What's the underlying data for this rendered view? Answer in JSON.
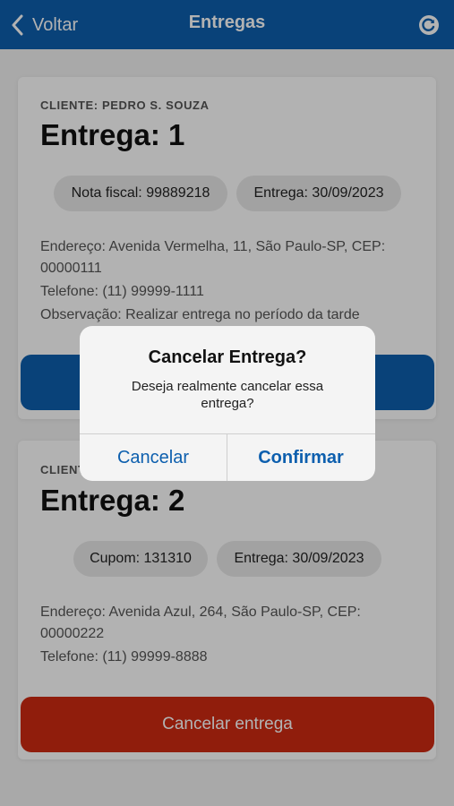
{
  "header": {
    "back_label": "Voltar",
    "title": "Entregas"
  },
  "deliveries": [
    {
      "client": "CLIENTE: PEDRO S. SOUZA",
      "title": "Entrega: 1",
      "chip1": "Nota fiscal: 99889218",
      "chip2": "Entrega: 30/09/2023",
      "address": "Endereço: Avenida Vermelha, 11, São Paulo-SP, CEP: 00000111",
      "phone": "Telefone: (11) 99999-1111",
      "note": "Observação: Realizar entrega no período da tarde"
    },
    {
      "client": "CLIENTE",
      "title": "Entrega: 2",
      "chip1": "Cupom: 131310",
      "chip2": "Entrega: 30/09/2023",
      "address": "Endereço: Avenida Azul, 264, São Paulo-SP, CEP: 00000222",
      "phone": "Telefone: (11) 99999-8888",
      "button": "Cancelar entrega"
    }
  ],
  "dialog": {
    "title": "Cancelar Entrega?",
    "message": "Deseja realmente cancelar essa entrega?",
    "cancel": "Cancelar",
    "confirm": "Confirmar"
  },
  "colors": {
    "primary": "#0d5fae",
    "danger": "#cf2a12"
  },
  "icons": {
    "back": "chevron-left-icon",
    "refresh": "refresh-icon"
  }
}
